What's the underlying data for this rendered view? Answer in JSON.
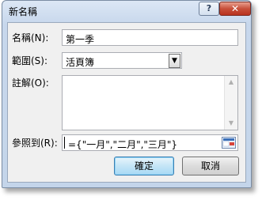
{
  "dialog": {
    "title": "新名稱",
    "help_label": "?",
    "close_label": "✕"
  },
  "form": {
    "name_label": "名稱(N):",
    "name_value": "第一季",
    "scope_label": "範圍(S):",
    "scope_value": "活頁簿",
    "comment_label": "註解(O):",
    "comment_value": "",
    "refers_label": "參照到(R):",
    "refers_value": "={\"一月\",\"二月\",\"三月\"}"
  },
  "buttons": {
    "ok_label": "確定",
    "cancel_label": "取消"
  },
  "icons": {
    "combo_arrow": "chevron-down-icon",
    "scroll_up": "arrow-up-icon",
    "scroll_down": "arrow-down-icon",
    "collapse": "collapse-dialog-icon"
  },
  "colors": {
    "close_button": "#c8503a",
    "default_button_border": "#3c7fb1"
  }
}
